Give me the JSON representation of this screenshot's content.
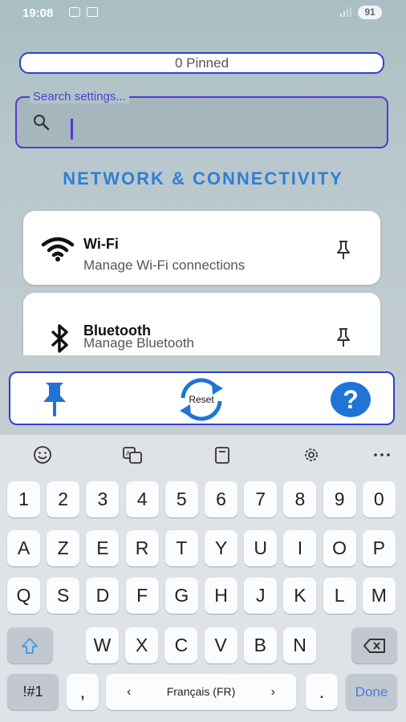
{
  "status_bar": {
    "time": "19:08",
    "battery": "91"
  },
  "pinned_bar": {
    "label": "0 Pinned"
  },
  "search": {
    "label": "Search settings...",
    "value": ""
  },
  "section_title": "NETWORK & CONNECTIVITY",
  "settings_items": [
    {
      "title": "Wi-Fi",
      "description": "Manage Wi-Fi connections",
      "icon": "wifi-icon"
    },
    {
      "title": "Bluetooth",
      "description": "Manage Bluetooth",
      "icon": "bluetooth-icon"
    }
  ],
  "bottom_bar": {
    "reset_label": "Reset"
  },
  "keyboard": {
    "toolbar_icons": [
      "emoji-icon",
      "translate-icon",
      "clipboard-icon",
      "settings-icon",
      "more-icon"
    ],
    "rows": [
      [
        "1",
        "2",
        "3",
        "4",
        "5",
        "6",
        "7",
        "8",
        "9",
        "0"
      ],
      [
        "A",
        "Z",
        "E",
        "R",
        "T",
        "Y",
        "U",
        "I",
        "O",
        "P"
      ],
      [
        "Q",
        "S",
        "D",
        "F",
        "G",
        "H",
        "J",
        "K",
        "L",
        "M"
      ],
      [
        "W",
        "X",
        "C",
        "V",
        "B",
        "N"
      ]
    ],
    "symbols_key": "!#1",
    "comma_key": ",",
    "language": "Français (FR)",
    "period_key": ".",
    "done_key": "Done",
    "colors": {
      "done": "#4a7fd6",
      "shift": "#4a9fe0"
    }
  },
  "colors": {
    "accent": "#2f7fd6",
    "border": "#2d3fd0",
    "search_border": "#5a36d0"
  }
}
